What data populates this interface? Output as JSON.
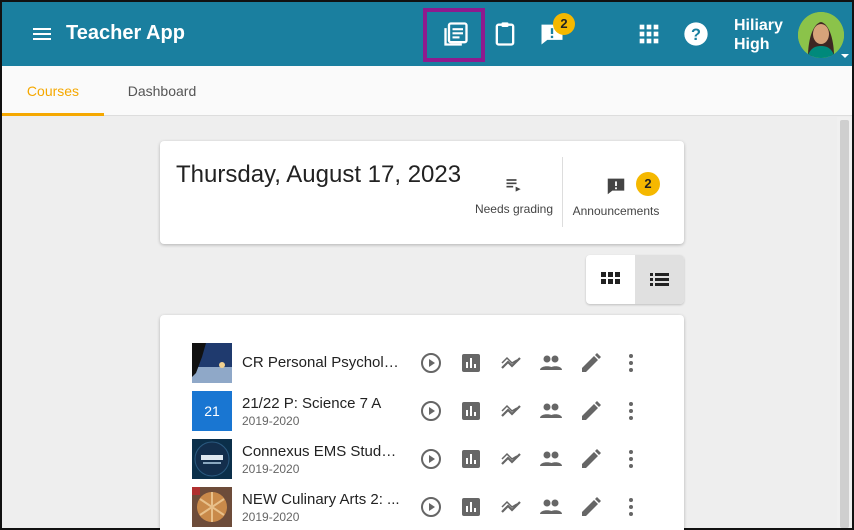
{
  "app": {
    "title": "Teacher App"
  },
  "header": {
    "school_name": "Hiliary High",
    "alerts_badge": "2",
    "icons": [
      "menu-icon",
      "courses-book-icon",
      "clipboard-icon",
      "alert-message-icon",
      "apps-grid-icon",
      "help-icon",
      "avatar"
    ]
  },
  "tabs": [
    {
      "label": "Courses",
      "active": true
    },
    {
      "label": "Dashboard",
      "active": false
    }
  ],
  "summary": {
    "date": "Thursday, August 17, 2023",
    "needs_grading_label": "Needs grading",
    "announcements_label": "Announcements",
    "announcements_count": "2"
  },
  "view_toggle": {
    "selected": "list"
  },
  "courses": [
    {
      "title": "CR Personal Psycholo...",
      "year": "",
      "thumb": "image"
    },
    {
      "title": "21/22 P: Science 7 A",
      "year": "2019-2020",
      "thumb": "21"
    },
    {
      "title": "Connexus EMS Stude...",
      "year": "2019-2020",
      "thumb": "image"
    },
    {
      "title": "NEW Culinary Arts 2: ...",
      "year": "2019-2020",
      "thumb": "image"
    }
  ],
  "colors": {
    "appbar": "#1a7f9f",
    "accent": "#f5a800",
    "highlight": "#8e1b8e",
    "badge": "#f5b800"
  }
}
